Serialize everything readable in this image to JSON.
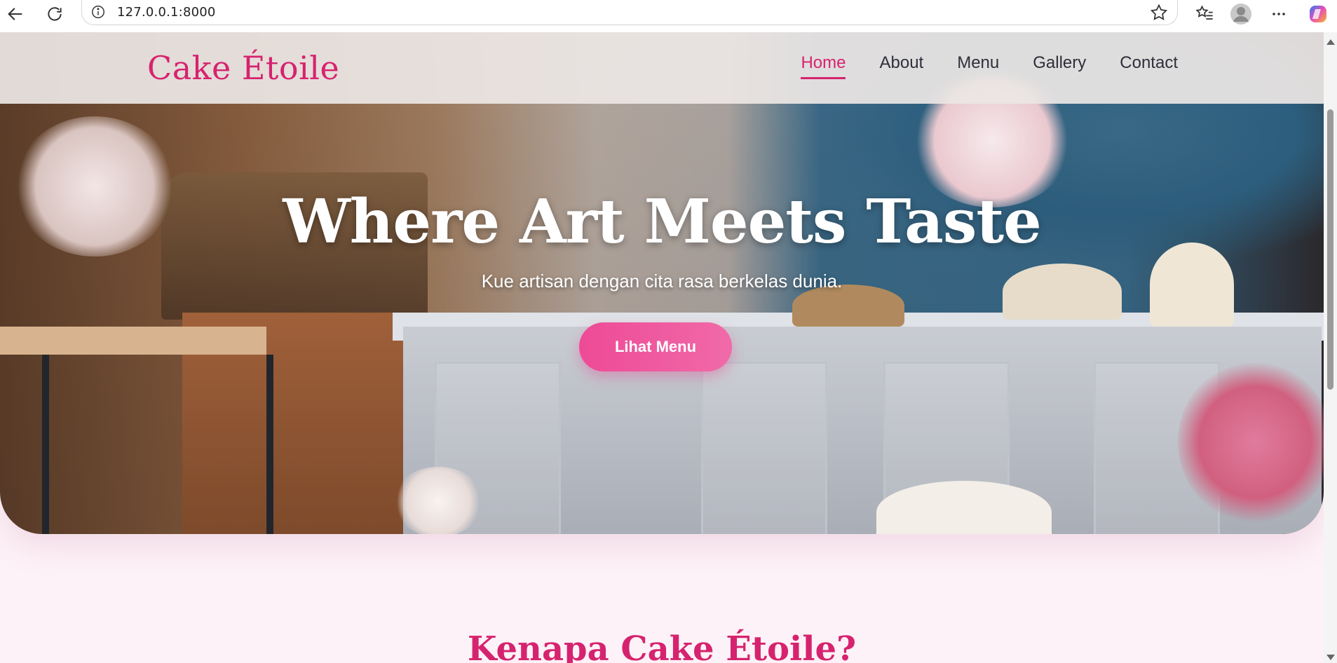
{
  "browser": {
    "url": "127.0.0.1:8000",
    "icons": [
      "back-arrow-icon",
      "reload-icon",
      "site-info-icon",
      "bookmark-star-icon",
      "favorites-icon",
      "profile-avatar-icon",
      "more-icon",
      "copilot-icon"
    ]
  },
  "site": {
    "brand": "Cake Étoile",
    "nav": [
      {
        "label": "Home",
        "active": true
      },
      {
        "label": "About",
        "active": false
      },
      {
        "label": "Menu",
        "active": false
      },
      {
        "label": "Gallery",
        "active": false
      },
      {
        "label": "Contact",
        "active": false
      }
    ]
  },
  "hero": {
    "title": "Where Art Meets Taste",
    "subtitle": "Kue artisan dengan cita rasa berkelas dunia.",
    "cta": "Lihat Menu"
  },
  "next_section": {
    "title": "Kenapa Cake Étoile?"
  },
  "colors": {
    "accent": "#d6236f",
    "button": "#ee4a96",
    "page_bg": "#fdf2f7"
  }
}
